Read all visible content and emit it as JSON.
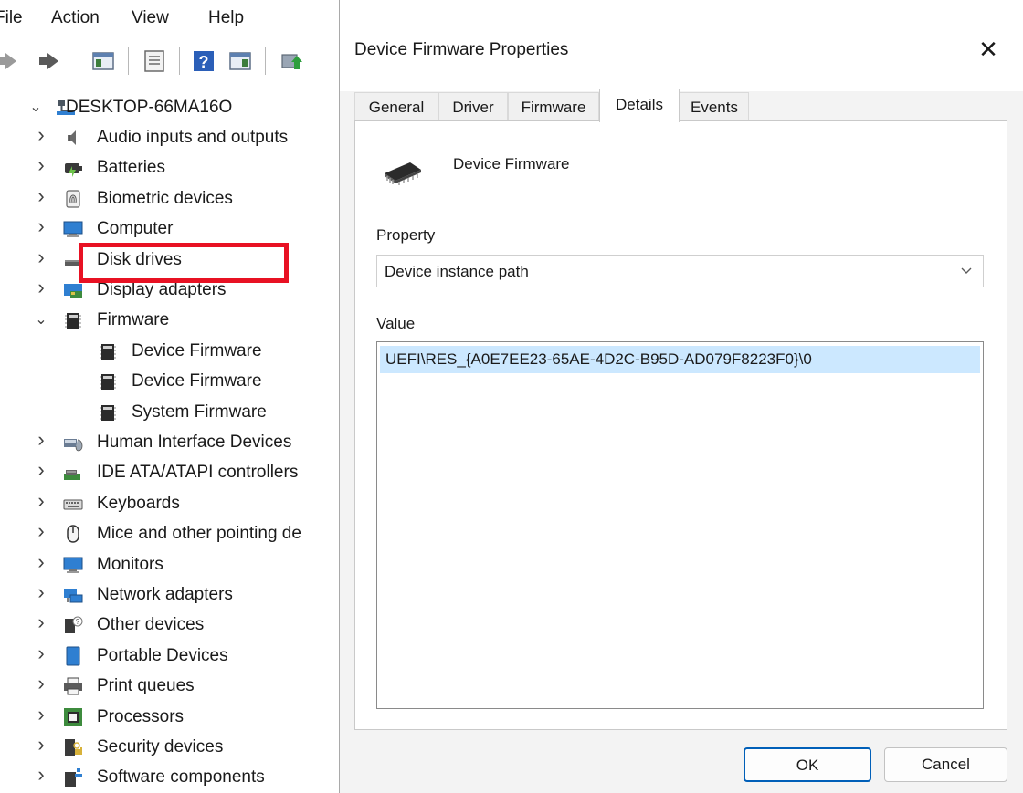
{
  "menu": [
    "File",
    "Action",
    "View",
    "Help"
  ],
  "tree": {
    "root": "DESKTOP-66MA16O",
    "items": [
      {
        "label": "Audio inputs and outputs",
        "icon": "speaker-icon",
        "state": "collapsed"
      },
      {
        "label": "Batteries",
        "icon": "battery-icon",
        "state": "collapsed"
      },
      {
        "label": "Biometric devices",
        "icon": "fingerprint-icon",
        "state": "collapsed"
      },
      {
        "label": "Computer",
        "icon": "monitor-icon",
        "state": "collapsed"
      },
      {
        "label": "Disk drives",
        "icon": "disk-drive-icon",
        "state": "collapsed"
      },
      {
        "label": "Display adapters",
        "icon": "display-adapter-icon",
        "state": "collapsed"
      },
      {
        "label": "Firmware",
        "icon": "chip-icon",
        "state": "expanded"
      },
      {
        "label": "Device Firmware",
        "icon": "chip-icon",
        "state": "child",
        "highlighted": true
      },
      {
        "label": "Device Firmware",
        "icon": "chip-icon",
        "state": "child"
      },
      {
        "label": "System Firmware",
        "icon": "chip-icon",
        "state": "child"
      },
      {
        "label": "Human Interface Devices",
        "icon": "hid-icon",
        "state": "collapsed"
      },
      {
        "label": "IDE ATA/ATAPI controllers",
        "icon": "ide-controller-icon",
        "state": "collapsed"
      },
      {
        "label": "Keyboards",
        "icon": "keyboard-icon",
        "state": "collapsed"
      },
      {
        "label": "Mice and other pointing de",
        "icon": "mouse-icon",
        "state": "collapsed"
      },
      {
        "label": "Monitors",
        "icon": "monitor-icon",
        "state": "collapsed"
      },
      {
        "label": "Network adapters",
        "icon": "network-adapter-icon",
        "state": "collapsed"
      },
      {
        "label": "Other devices",
        "icon": "unknown-device-icon",
        "state": "collapsed"
      },
      {
        "label": "Portable Devices",
        "icon": "portable-device-icon",
        "state": "collapsed"
      },
      {
        "label": "Print queues",
        "icon": "printer-icon",
        "state": "collapsed"
      },
      {
        "label": "Processors",
        "icon": "processor-icon",
        "state": "collapsed"
      },
      {
        "label": "Security devices",
        "icon": "security-device-icon",
        "state": "collapsed"
      },
      {
        "label": "Software components",
        "icon": "software-component-icon",
        "state": "collapsed"
      }
    ]
  },
  "dialog": {
    "title": "Device Firmware Properties",
    "close_glyph": "✕",
    "tabs": [
      "General",
      "Driver",
      "Firmware",
      "Details",
      "Events"
    ],
    "active_tab": "Details",
    "device_name": "Device Firmware",
    "property_label": "Property",
    "property_value": "Device instance path",
    "value_label": "Value",
    "value_text": "UEFI\\RES_{A0E7EE23-65AE-4D2C-B95D-AD079F8223F0}\\0",
    "ok_label": "OK",
    "cancel_label": "Cancel"
  },
  "colors": {
    "highlight_border": "#e81123",
    "selection_bg": "#cce8ff",
    "ok_border": "#005fb8",
    "dialog_bg": "#f3f3f3"
  }
}
